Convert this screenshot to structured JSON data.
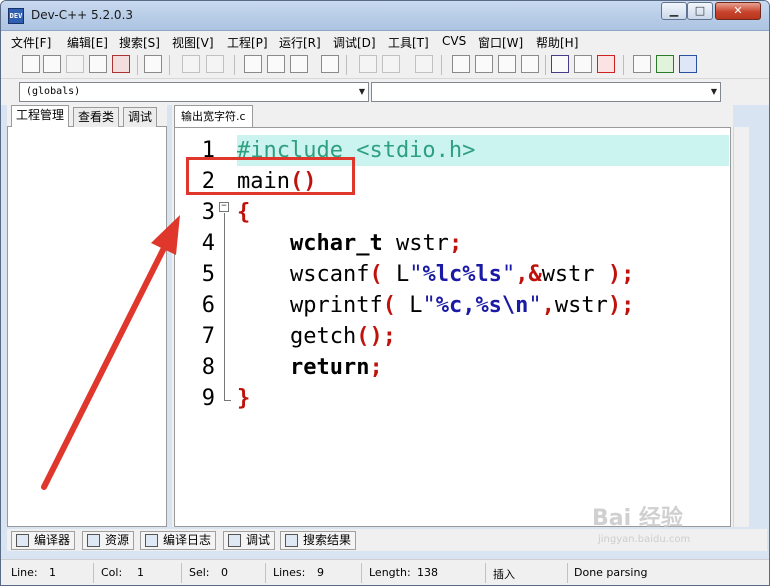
{
  "window": {
    "title": "Dev-C++ 5.2.0.3",
    "app_icon": "DEV"
  },
  "window_controls": {
    "minimize": "▁",
    "maximize": "□",
    "close": "✕"
  },
  "menu": [
    {
      "id": "file",
      "label": "文件[F]"
    },
    {
      "id": "edit",
      "label": "编辑[E]"
    },
    {
      "id": "search",
      "label": "搜索[S]"
    },
    {
      "id": "view",
      "label": "视图[V]"
    },
    {
      "id": "project",
      "label": "工程[P]"
    },
    {
      "id": "run",
      "label": "运行[R]"
    },
    {
      "id": "debug",
      "label": "调试[D]"
    },
    {
      "id": "tools",
      "label": "工具[T]"
    },
    {
      "id": "cvs",
      "label": "CVS"
    },
    {
      "id": "window",
      "label": "窗口[W]"
    },
    {
      "id": "help",
      "label": "帮助[H]"
    }
  ],
  "toolbar_icons": [
    "new-file-icon",
    "open-file-icon",
    "save-icon",
    "save-all-icon",
    "close-file-icon",
    "print-icon",
    "undo-icon",
    "redo-icon",
    "find-icon",
    "replace-icon",
    "find-next-icon",
    "goto-line-icon",
    "back-icon",
    "forward-icon",
    "bookmark-icon",
    "compile-icon",
    "run-icon",
    "compile-run-icon",
    "rebuild-icon",
    "check-syntax-icon",
    "profile-icon",
    "stop-icon",
    "new-project-icon",
    "add-to-project-icon",
    "remove-from-project-icon"
  ],
  "combos": {
    "scope": "(globals)",
    "member": ""
  },
  "left_tabs": [
    "工程管理",
    "查看类",
    "调试"
  ],
  "editor": {
    "tab_label": "输出宽字符.c",
    "current_line": 1,
    "lines": [
      {
        "no": "1",
        "tokens": [
          {
            "t": "#include <stdio.h>",
            "c": "pre"
          }
        ]
      },
      {
        "no": "2",
        "tokens": [
          {
            "t": "main",
            "c": "plain"
          },
          {
            "t": "()",
            "c": "sym"
          }
        ]
      },
      {
        "no": "3",
        "tokens": [
          {
            "t": "{",
            "c": "sym"
          }
        ]
      },
      {
        "no": "4",
        "tokens": [
          {
            "t": "    ",
            "c": "plain"
          },
          {
            "t": "wchar_t",
            "c": "kw"
          },
          {
            "t": " wstr",
            "c": "plain"
          },
          {
            "t": ";",
            "c": "sym"
          }
        ]
      },
      {
        "no": "5",
        "tokens": [
          {
            "t": "    wscanf",
            "c": "plain"
          },
          {
            "t": "(",
            "c": "sym"
          },
          {
            "t": " L",
            "c": "plain"
          },
          {
            "t": "\"",
            "c": "str"
          },
          {
            "t": "%lc%ls",
            "c": "esc"
          },
          {
            "t": "\"",
            "c": "str"
          },
          {
            "t": ",",
            "c": "sym"
          },
          {
            "t": "&",
            "c": "sym"
          },
          {
            "t": "wstr ",
            "c": "plain"
          },
          {
            "t": ");",
            "c": "sym"
          }
        ]
      },
      {
        "no": "6",
        "tokens": [
          {
            "t": "    wprintf",
            "c": "plain"
          },
          {
            "t": "(",
            "c": "sym"
          },
          {
            "t": " L",
            "c": "plain"
          },
          {
            "t": "\"",
            "c": "str"
          },
          {
            "t": "%c,%s\\n",
            "c": "esc"
          },
          {
            "t": "\"",
            "c": "str"
          },
          {
            "t": ",",
            "c": "sym"
          },
          {
            "t": "wstr",
            "c": "plain"
          },
          {
            "t": ");",
            "c": "sym"
          }
        ]
      },
      {
        "no": "7",
        "tokens": [
          {
            "t": "    getch",
            "c": "plain"
          },
          {
            "t": "();",
            "c": "sym"
          }
        ]
      },
      {
        "no": "8",
        "tokens": [
          {
            "t": "    ",
            "c": "plain"
          },
          {
            "t": "return",
            "c": "kw"
          },
          {
            "t": ";",
            "c": "sym"
          }
        ]
      },
      {
        "no": "9",
        "tokens": [
          {
            "t": "}",
            "c": "sym"
          }
        ]
      }
    ]
  },
  "bottom_tabs": [
    {
      "label": "编译器",
      "icon": "compiler-icon"
    },
    {
      "label": "资源",
      "icon": "resources-icon"
    },
    {
      "label": "编译日志",
      "icon": "compile-log-icon"
    },
    {
      "label": "调试",
      "icon": "debug-icon"
    },
    {
      "label": "搜索结果",
      "icon": "search-results-icon"
    }
  ],
  "status": {
    "line_label": "Line:",
    "line_value": "1",
    "col_label": "Col:",
    "col_value": "1",
    "sel_label": "Sel:",
    "sel_value": "0",
    "lines_label": "Lines:",
    "lines_value": "9",
    "length_label": "Length:",
    "length_value": "138",
    "mode": "插入",
    "parse_status": "Done parsing"
  },
  "watermark": {
    "main": "Bai 经验",
    "sub": "jingyan.baidu.com"
  },
  "colors": {
    "current_line_bg": "#cbf4f0",
    "preprocessor": "#2fa07f",
    "symbol": "#c0120c",
    "string": "#1a1aa6",
    "annotation": "#e0372c"
  }
}
